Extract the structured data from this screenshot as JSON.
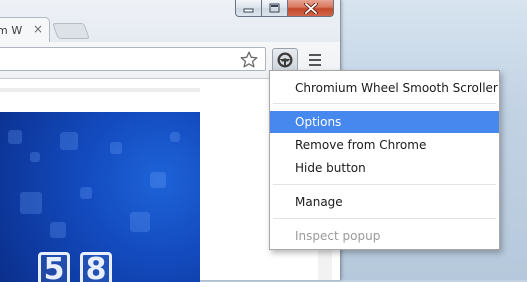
{
  "browser": {
    "tab_title": "m W",
    "tab_close": "×"
  },
  "hero": {
    "digits": [
      "5",
      "8"
    ]
  },
  "context_menu": {
    "items": [
      {
        "label": "Chromium Wheel Smooth Scroller",
        "state": "normal"
      },
      {
        "label": "Options",
        "state": "highlighted"
      },
      {
        "label": "Remove from Chrome",
        "state": "normal"
      },
      {
        "label": "Hide button",
        "state": "normal"
      },
      {
        "label": "Manage",
        "state": "normal"
      },
      {
        "label": "Inspect popup",
        "state": "disabled"
      }
    ]
  },
  "colors": {
    "highlight": "#4688ee",
    "close_button": "#c4482b",
    "hero_blue": "#134bbf"
  }
}
